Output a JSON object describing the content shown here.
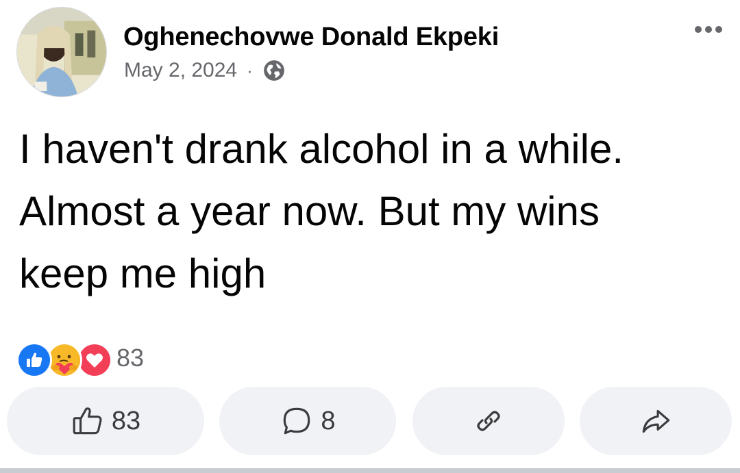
{
  "post": {
    "author_name": "Oghenechovwe Donald Ekpeki",
    "date": "May 2, 2024",
    "separator": "·",
    "privacy_icon": "globe-icon",
    "menu_icon": "more-options-icon",
    "text_lines": [
      "I haven't drank alcohol in a while.",
      "Almost a year now. But my wins",
      "keep me high"
    ]
  },
  "reactions": {
    "icons": [
      "like-reaction-icon",
      "care-reaction-icon",
      "love-reaction-icon"
    ],
    "total": "83"
  },
  "actions": {
    "like_count": "83",
    "comment_count": "8",
    "copy_icon": "link-icon",
    "share_icon": "share-icon"
  },
  "colors": {
    "like_blue": "#1877f2",
    "love_red": "#f33e58",
    "care_yellow": "#f7b928",
    "button_bg": "#f0f2f5",
    "secondary_text": "#65676b"
  }
}
